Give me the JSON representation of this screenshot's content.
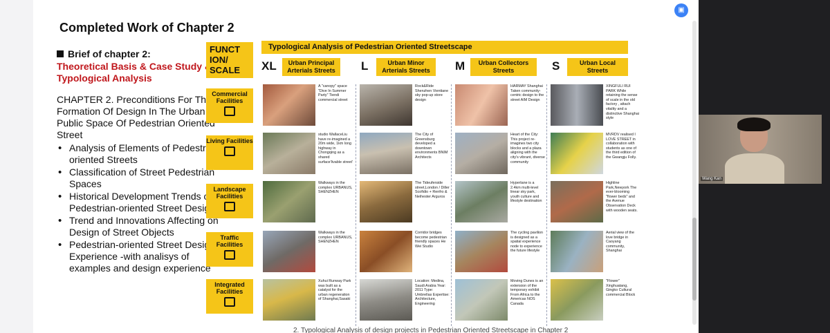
{
  "slide": {
    "title": "Completed Work of Chapter 2",
    "brief_heading": "Brief of  chapter 2:",
    "brief_red": "Theoretical Basis & Case Study & Typological Analysis",
    "chapter_text": "CHAPTER 2. Preconditions For The Formation Of Design In The Urban Public Space Of Pedestrian Oriented Street",
    "bullets": [
      "Analysis of Elements of Pedestrian-oriented Streets",
      "Classification of Street Pedestrian Spaces",
      "Historical Development Trends of Pedestrian-oriented Street Design",
      "Trend and Innovations Affecting on Design of Street Objects",
      "Pedestrian-oriented Street Design Experience -with analisys of examples and design experience"
    ],
    "func_label": "FUNCT ION/ SCALE",
    "header_bar": "Typological Analysis of Pedestrian Oriented Streetscape",
    "scales": [
      {
        "letter": "XL",
        "label": "Urban Principal Arterials Streets"
      },
      {
        "letter": "L",
        "label": "Urban Minor Arterials Streets"
      },
      {
        "letter": "M",
        "label": "Urban Collectors Streets"
      },
      {
        "letter": "S",
        "label": "Urban Local Streets"
      }
    ],
    "categories": [
      "Commercial Facilities",
      "Living Facilities",
      "Landscape Facilities",
      "Traffic Facilities",
      "Integrated Facilities"
    ],
    "cells": [
      [
        "A \"canopy\" space \"Dive In Summer Party\" Tiendi commercial street",
        "Rock&Ride Shenzhen Vientiane sky pop-up store design",
        "HARMAY Shanghai Taken community-centric design to the street AIM Design",
        "XINGFULI RUI PARK While retaining the sense of scale in the old factory , attach vitality and a distinctive Shanghai style"
      ],
      [
        "studio WallaceLiu have re-imagined a 20m wide, 1km long highway in Chongqing as a shared surface'livable street'",
        "The City of Greensburg developed a downtown environments BNIM Architects",
        "Heart of the City: This project re-imagines two city blocks and a plaza aligning with the city's vibrant, diverse community",
        "MVRDV realised I LOVE STREET in collaboration with students as one of the third edition of the Gwangju Folly."
      ],
      [
        "Walkways in the complex URBANUS, SHENZHEN",
        "The Tideuferside street,London / Diller Scofidio + Renfro & Neihester Arguros",
        "Hyperlane is a 2.4km multi-level linear sky park, youth culture and lifestyle destination",
        "Highline Park,Newyork The ever-blooming \"flower beds\" and the Avenue Observation Deck with wooden seats."
      ],
      [
        "Walkways in the complex URBANUS, SHENZHEN",
        "Corridor bridges become pedestrian friendly spaces He Wei Studio",
        "The cycling pavilion is designed as a spatial experience node to experience the future lifestyle",
        "Aerial view of the love bridge in Caoyang community, Shanghai"
      ],
      [
        "Xuhui Runway Park was built as a catalyst for the urban regeneration of Shanghai,Sasaki",
        "Location: Medina, Saudi Arabia Year: 2011 Type: Umbrellas Expertise: Architecture, Engineering",
        "Moving Dunes is an extension of the temporary exhibit From Africa to the Americas NOS Canada",
        "\"Flower\" Xinghuatang, Gingko Cultural commercial Block"
      ]
    ],
    "caption": "2. Typological Analysis of design projects in Pedestrian Oriented Streetscape in Chapter 2"
  },
  "video": {
    "participant_name": "Wang Kan"
  },
  "colors": {
    "accent_yellow": "#f5c518",
    "brief_red": "#c0171c",
    "camera_button": "#3b82f6"
  },
  "icons": {
    "top_button": "share-screen-icon"
  }
}
